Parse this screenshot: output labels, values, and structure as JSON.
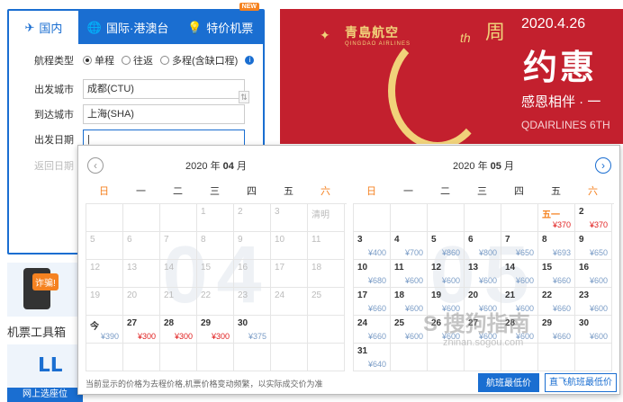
{
  "tabs": [
    {
      "label": "国内",
      "icon": "plane-icon"
    },
    {
      "label": "国际·港澳台",
      "icon": "globe-icon"
    },
    {
      "label": "特价机票",
      "icon": "lightbulb-icon"
    }
  ],
  "new_badge": "NEW",
  "form": {
    "trip_type_label": "航程类型",
    "trip_types": [
      "单程",
      "往返",
      "多程(含缺口程)"
    ],
    "from_label": "出发城市",
    "from_value": "成都(CTU)",
    "to_label": "到达城市",
    "to_value": "上海(SHA)",
    "depart_label": "出发日期",
    "return_label": "返回日期"
  },
  "ad": {
    "brand_cn": "青島航空",
    "brand_en": "QINGDAO AIRLINES",
    "th": "th",
    "zhou": "周",
    "date": "2020.4.26",
    "title": "约惠",
    "subtitle": "感恩相伴 · 一",
    "english": "QDAIRLINES 6TH"
  },
  "toolbox": {
    "scam_label": "诈骗!",
    "title": "机票工具箱"
  },
  "seat": {
    "label": "网上选座位",
    "icon": "seat-icon"
  },
  "calendar": {
    "weekdays": [
      "日",
      "一",
      "二",
      "三",
      "四",
      "五",
      "六"
    ],
    "april": {
      "year_prefix": "2020 年 ",
      "month_num": "04",
      "month_suffix": " 月",
      "big": "04",
      "offset": 0,
      "days": [
        {
          "d": "",
          "p": ""
        },
        {
          "d": "",
          "p": ""
        },
        {
          "d": "",
          "p": ""
        },
        {
          "d": "1",
          "p": "",
          "past": true
        },
        {
          "d": "2",
          "p": "",
          "past": true
        },
        {
          "d": "3",
          "p": "",
          "past": true
        },
        {
          "d": "清明",
          "p": "",
          "past": true
        },
        {
          "d": "5",
          "p": "",
          "past": true
        },
        {
          "d": "6",
          "p": "",
          "past": true
        },
        {
          "d": "7",
          "p": "",
          "past": true
        },
        {
          "d": "8",
          "p": "",
          "past": true
        },
        {
          "d": "9",
          "p": "",
          "past": true
        },
        {
          "d": "10",
          "p": "",
          "past": true
        },
        {
          "d": "11",
          "p": "",
          "past": true
        },
        {
          "d": "12",
          "p": "",
          "past": true
        },
        {
          "d": "13",
          "p": "",
          "past": true
        },
        {
          "d": "14",
          "p": "",
          "past": true
        },
        {
          "d": "15",
          "p": "",
          "past": true
        },
        {
          "d": "16",
          "p": "",
          "past": true
        },
        {
          "d": "17",
          "p": "",
          "past": true
        },
        {
          "d": "18",
          "p": "",
          "past": true
        },
        {
          "d": "19",
          "p": "",
          "past": true
        },
        {
          "d": "20",
          "p": "",
          "past": true
        },
        {
          "d": "21",
          "p": "",
          "past": true
        },
        {
          "d": "22",
          "p": "",
          "past": true
        },
        {
          "d": "23",
          "p": "",
          "past": true
        },
        {
          "d": "24",
          "p": "",
          "past": true
        },
        {
          "d": "25",
          "p": "",
          "past": true
        },
        {
          "d": "今",
          "p": "¥390"
        },
        {
          "d": "27",
          "p": "¥300",
          "low": true
        },
        {
          "d": "28",
          "p": "¥300",
          "low": true
        },
        {
          "d": "29",
          "p": "¥300",
          "low": true
        },
        {
          "d": "30",
          "p": "¥375"
        },
        {
          "d": "",
          "p": ""
        },
        {
          "d": "",
          "p": ""
        },
        {
          "d": "",
          "p": ""
        },
        {
          "d": "",
          "p": ""
        },
        {
          "d": "",
          "p": ""
        },
        {
          "d": "",
          "p": ""
        },
        {
          "d": "",
          "p": ""
        },
        {
          "d": "",
          "p": ""
        },
        {
          "d": "",
          "p": ""
        }
      ]
    },
    "may": {
      "year_prefix": "2020 年 ",
      "month_num": "05",
      "month_suffix": " 月",
      "big": "05",
      "days": [
        {
          "d": "",
          "p": ""
        },
        {
          "d": "",
          "p": ""
        },
        {
          "d": "",
          "p": ""
        },
        {
          "d": "",
          "p": ""
        },
        {
          "d": "",
          "p": ""
        },
        {
          "d": "五一",
          "p": "¥370",
          "low": true,
          "hol": true
        },
        {
          "d": "2",
          "p": "¥370",
          "low": true
        },
        {
          "d": "3",
          "p": "¥400"
        },
        {
          "d": "4",
          "p": "¥700"
        },
        {
          "d": "5",
          "p": "¥860"
        },
        {
          "d": "6",
          "p": "¥800"
        },
        {
          "d": "7",
          "p": "¥650"
        },
        {
          "d": "8",
          "p": "¥693"
        },
        {
          "d": "9",
          "p": "¥650"
        },
        {
          "d": "10",
          "p": "¥680"
        },
        {
          "d": "11",
          "p": "¥600"
        },
        {
          "d": "12",
          "p": "¥600"
        },
        {
          "d": "13",
          "p": "¥600"
        },
        {
          "d": "14",
          "p": "¥600"
        },
        {
          "d": "15",
          "p": "¥660"
        },
        {
          "d": "16",
          "p": "¥600"
        },
        {
          "d": "17",
          "p": "¥660"
        },
        {
          "d": "18",
          "p": "¥600"
        },
        {
          "d": "19",
          "p": "¥600"
        },
        {
          "d": "20",
          "p": "¥600"
        },
        {
          "d": "21",
          "p": "¥600"
        },
        {
          "d": "22",
          "p": "¥660"
        },
        {
          "d": "23",
          "p": "¥600"
        },
        {
          "d": "24",
          "p": "¥660"
        },
        {
          "d": "25",
          "p": "¥600"
        },
        {
          "d": "26",
          "p": "¥600"
        },
        {
          "d": "27",
          "p": "¥600"
        },
        {
          "d": "28",
          "p": "¥600"
        },
        {
          "d": "29",
          "p": "¥660"
        },
        {
          "d": "30",
          "p": "¥600"
        },
        {
          "d": "31",
          "p": "¥640"
        },
        {
          "d": "",
          "p": ""
        },
        {
          "d": "",
          "p": ""
        },
        {
          "d": "",
          "p": ""
        },
        {
          "d": "",
          "p": ""
        },
        {
          "d": "",
          "p": ""
        },
        {
          "d": "",
          "p": ""
        }
      ]
    },
    "footer": "当前显示的价格为去程价格,机票价格变动频繁，以实际成交价为准",
    "btn_lowest": "航班最低价",
    "btn_direct": "直飞航班最低价"
  },
  "watermark": "S 搜狗指南",
  "watermark_url": "zhinan.sogou.com",
  "colors": {
    "primary": "#1a6ed1",
    "accent": "#f58220",
    "ad_red": "#c3202e",
    "price_low": "#e02020"
  }
}
